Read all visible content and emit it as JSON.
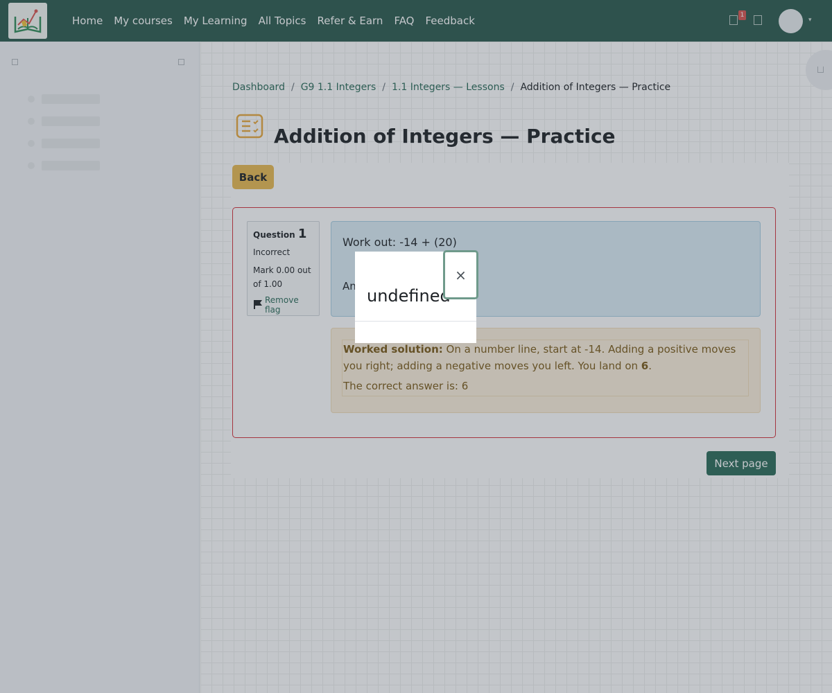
{
  "nav": {
    "links": [
      "Home",
      "My courses",
      "My Learning",
      "All Topics",
      "Refer & Earn",
      "FAQ",
      "Feedback"
    ],
    "notification_count": "1"
  },
  "breadcrumb": {
    "items": [
      "Dashboard",
      "G9 1.1 Integers",
      "1.1 Integers — Lessons"
    ],
    "separator": "/",
    "current": "Addition of Integers — Practice"
  },
  "page": {
    "title": "Addition of Integers — Practice",
    "back_label": "Back",
    "next_label": "Next page"
  },
  "question": {
    "label": "Question",
    "number": "1",
    "state": "Incorrect",
    "grade": "Mark 0.00 out of 1.00",
    "flag_label": "Remove flag",
    "text": "Work out: -14 + (20)",
    "answer_label": "An"
  },
  "feedback": {
    "heading": "Worked solution:",
    "text": " On a number line, start at -14. Adding a positive moves you right; adding a negative moves you left. You land on ",
    "result": "6",
    "end": ".",
    "correct_answer": "The correct answer is: 6"
  },
  "popup": {
    "body": "undefined",
    "close_symbol": "×"
  },
  "colors": {
    "navbar": "#2a5a4d",
    "accent": "#2a6b58",
    "back_button": "#e9b94f",
    "incorrect_border": "#d5303a"
  }
}
